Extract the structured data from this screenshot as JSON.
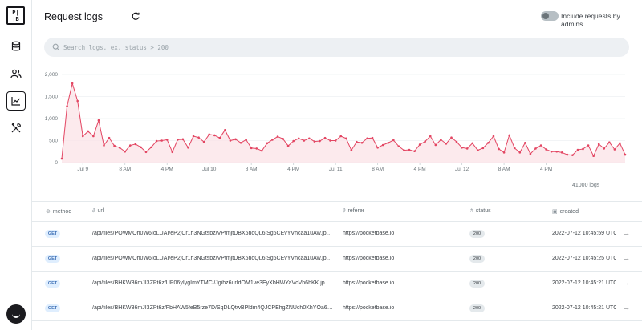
{
  "logo": {
    "line1": "P|",
    "line2": "|B"
  },
  "header": {
    "title": "Request logs",
    "admin_toggle_label": "Include requests by admins"
  },
  "search": {
    "placeholder": "Search logs, ex. status > 200",
    "value": ""
  },
  "chart_data": {
    "type": "area",
    "ylim": [
      0,
      2000
    ],
    "yticks": [
      "0",
      "500",
      "1,000",
      "1,500",
      "2,000"
    ],
    "xtick_labels": [
      "Jul 9",
      "8 AM",
      "4 PM",
      "Jul 10",
      "8 AM",
      "4 PM",
      "Jul 11",
      "8 AM",
      "4 PM",
      "Jul 12",
      "8 AM",
      "4 PM"
    ],
    "x_start": "2022-07-08 20:00",
    "x_interval_hours": 1,
    "values": [
      90,
      1280,
      1800,
      1400,
      600,
      710,
      600,
      960,
      390,
      560,
      380,
      340,
      250,
      390,
      420,
      350,
      240,
      350,
      490,
      500,
      520,
      240,
      520,
      530,
      340,
      600,
      570,
      470,
      640,
      620,
      560,
      740,
      500,
      530,
      450,
      520,
      330,
      320,
      270,
      440,
      520,
      590,
      540,
      380,
      490,
      550,
      500,
      550,
      480,
      490,
      560,
      500,
      500,
      600,
      550,
      280,
      470,
      450,
      550,
      560,
      340,
      400,
      450,
      510,
      370,
      280,
      290,
      260,
      410,
      480,
      600,
      400,
      520,
      430,
      570,
      470,
      340,
      320,
      440,
      280,
      330,
      450,
      600,
      310,
      230,
      620,
      330,
      230,
      450,
      200,
      320,
      390,
      300,
      250,
      250,
      230,
      180,
      170,
      290,
      310,
      390,
      150,
      420,
      320,
      460,
      300,
      440,
      180
    ]
  },
  "total_count": "41000 logs",
  "table": {
    "headers": {
      "method": "method",
      "url": "url",
      "referer": "referer",
      "status": "status",
      "created": "created"
    },
    "rows": [
      {
        "method": "GET",
        "url": "/api/files/POWMOh0W6IoLUAI/eP2jCr1h3NGtsbz/VPtmjtDBX6noQL6iSg6CEvYVhcaa1uAw.jpg?t...",
        "referer": "https://pocketbase.io",
        "status": "200",
        "created": "2022-07-12 10:45:59 UTC"
      },
      {
        "method": "GET",
        "url": "/api/files/POWMOh0W6IoLUAI/eP2jCr1h3NGtsbz/VPtmjtDBX6noQL6iSg6CEvYVhcaa1uAw.jpg?t...",
        "referer": "https://pocketbase.io",
        "status": "200",
        "created": "2022-07-12 10:45:25 UTC"
      },
      {
        "method": "GET",
        "url": "/api/files/BHKW36mJI3ZPt6z/UP06yIygImYTMCl/Jgihz6urIdOM1ve3EyXbHWYaVcVh6hKK.jpg?t...",
        "referer": "https://pocketbase.io",
        "status": "200",
        "created": "2022-07-12 10:45:21 UTC"
      },
      {
        "method": "GET",
        "url": "/api/files/BHKW36mJI3ZPt6z/FbHAW5feB5rze7D/SqDLQtwBPldm4QJCPEhgZNUch0KhYOa6.jpg...",
        "referer": "https://pocketbase.io",
        "status": "200",
        "created": "2022-07-12 10:45:21 UTC"
      }
    ]
  },
  "colors": {
    "accent": "#e34562",
    "fill": "#fbe3e7"
  }
}
